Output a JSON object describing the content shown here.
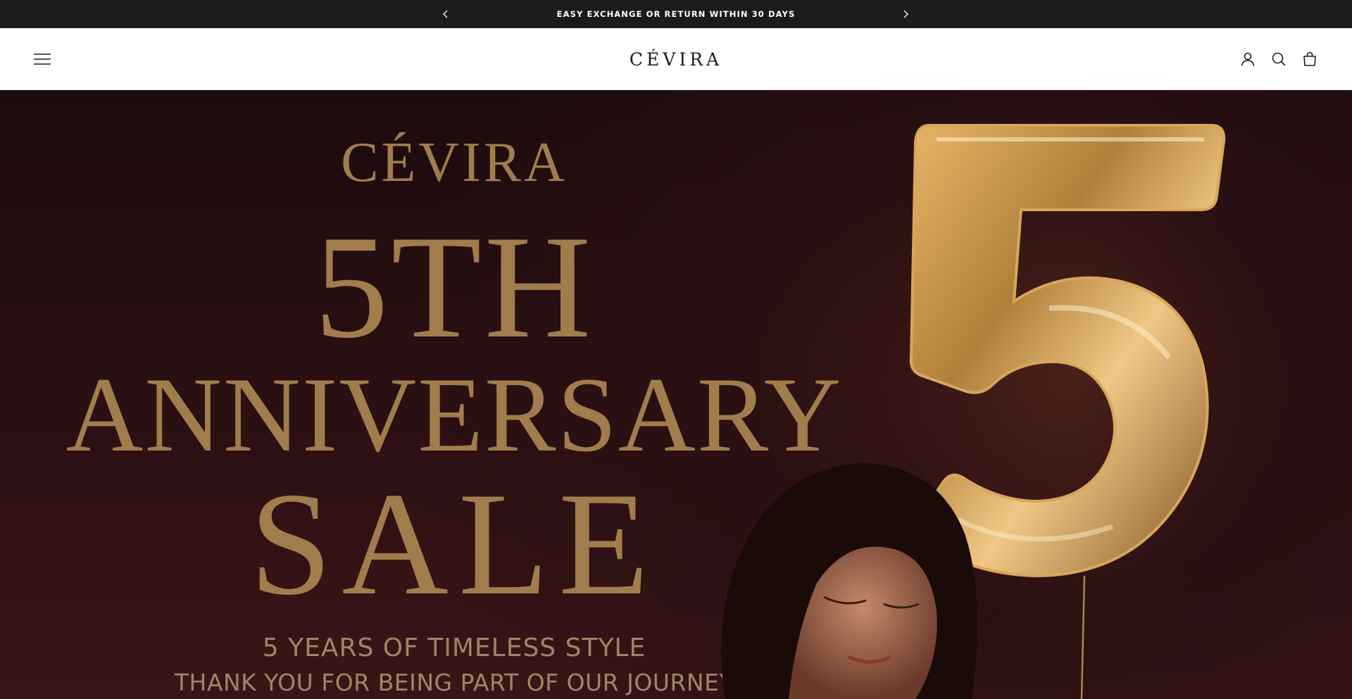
{
  "announcement": {
    "text": "EASY EXCHANGE OR RETURN WITHIN 30 DAYS",
    "prev_icon": "chevron-left-icon",
    "next_icon": "chevron-right-icon"
  },
  "header": {
    "logo": "CÉVIRA",
    "menu_icon": "hamburger-menu-icon",
    "account_icon": "user-account-icon",
    "search_icon": "search-icon",
    "cart_icon": "shopping-bag-icon"
  },
  "hero": {
    "brand": "CÉVIRA",
    "headline_1": "5TH",
    "headline_2": "ANNIVERSARY",
    "headline_3": "SALE",
    "subline_1": "5 YEARS OF TIMELESS STYLE",
    "subline_2": "THANK YOU FOR BEING PART OF OUR JOURNEY"
  },
  "colors": {
    "announcement_bg": "#1b1b1b",
    "hero_bg": "#2b1013",
    "gold_text": "#a17c4c",
    "balloon_gold": "#b0803a"
  }
}
